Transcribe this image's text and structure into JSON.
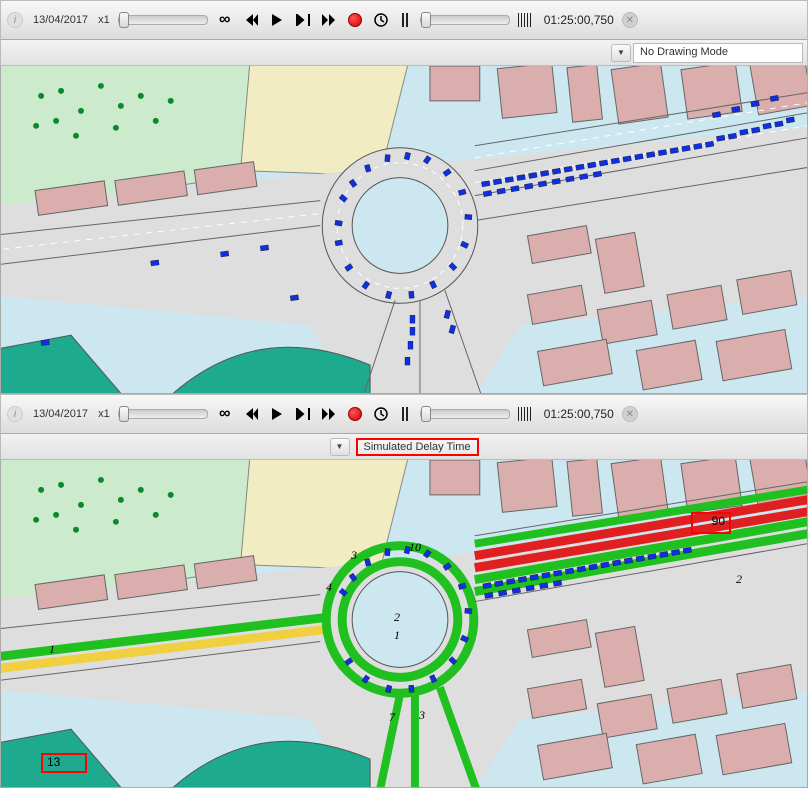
{
  "toolbar": {
    "date": "13/04/2017",
    "speed": "x1",
    "infinity_icon": "∞",
    "skip_back_icon": "|◀◀",
    "play_icon": "▶",
    "skip_fwd_icon": "▶|",
    "fast_fwd_icon": "▶▶",
    "record_icon": "●",
    "clock_icon": "◷",
    "timestamp": "01:25:00,750",
    "close_icon": "✕"
  },
  "mode_panel1": {
    "label": "No Drawing Mode"
  },
  "mode_panel2": {
    "label": "Simulated Delay Time"
  },
  "annotations": {
    "value_90": "90",
    "value_13": "13"
  },
  "map_labels": {
    "seg_1a": "1",
    "seg_1b": "1",
    "seg_2a": "2",
    "seg_2b": "2",
    "seg_3a": "3",
    "seg_3b": "3",
    "seg_4": "4",
    "seg_7": "7",
    "seg_10": "10"
  },
  "colors": {
    "water": "#cde7f0",
    "building": "#d9aeac",
    "park": "#cceacc",
    "park2": "#1daa8f",
    "sand": "#f2ecc3",
    "road": "#dedede",
    "road_line": "#888",
    "car": "#1030e0",
    "lane_green": "#20c020",
    "lane_yellow": "#f0d040",
    "lane_red": "#e02020"
  }
}
